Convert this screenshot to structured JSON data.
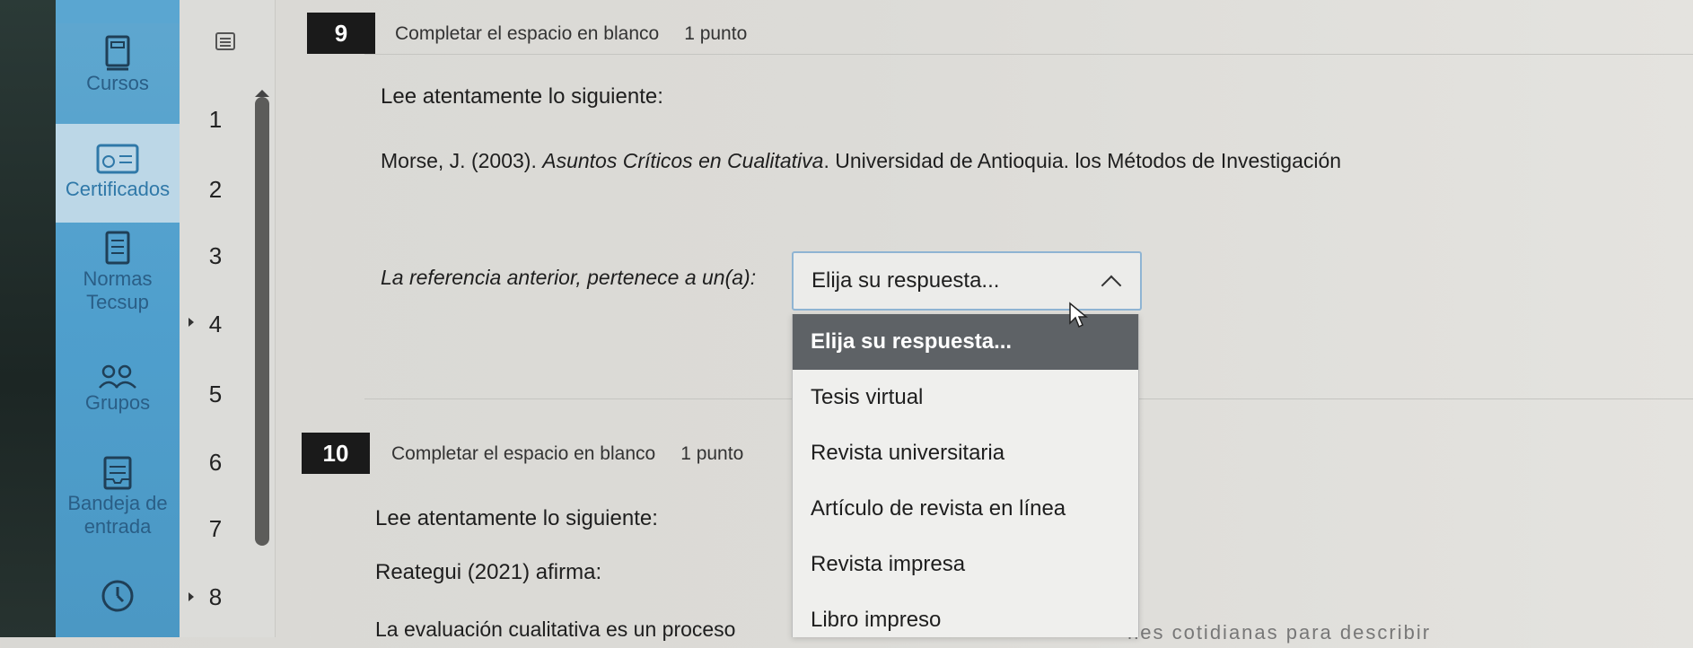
{
  "nav": {
    "items": [
      {
        "label": "Cursos",
        "icon": "book-icon",
        "active": false
      },
      {
        "label": "Certificados",
        "icon": "certificate-icon",
        "active": true
      },
      {
        "label": "Normas\nTecsup",
        "icon": "document-icon",
        "active": false
      },
      {
        "label": "Grupos",
        "icon": "groups-icon",
        "active": false
      },
      {
        "label": "Bandeja de\nentrada",
        "icon": "inbox-icon",
        "active": false
      },
      {
        "label": "",
        "icon": "clock-icon",
        "active": false
      }
    ]
  },
  "question_nav": {
    "numbers": [
      "1",
      "2",
      "3",
      "4",
      "5",
      "6",
      "7",
      "8"
    ]
  },
  "q9": {
    "number": "9",
    "type": "Completar el espacio en blanco",
    "points": "1 punto",
    "intro": "Lee atentamente lo siguiente:",
    "reference_prefix": "Morse, J. (2003). ",
    "reference_title": "Asuntos Críticos en Cualitativa",
    "reference_suffix": ". Universidad de Antioquia. los Métodos de Investigación",
    "prompt": "La referencia anterior, pertenece a un(a):",
    "select_value": "Elija su respuesta...",
    "options": [
      "Elija su respuesta...",
      "Tesis virtual",
      "Revista universitaria",
      "Artículo de revista en línea",
      "Revista impresa",
      "Libro impreso"
    ],
    "selected_option": "Elija su respuesta..."
  },
  "q10": {
    "number": "10",
    "type": "Completar el espacio en blanco",
    "points": "1 punto",
    "intro": "Lee atentamente lo siguiente:",
    "quote_intro": "Reategui (2021) afirma:",
    "quote_start": "La evaluación cualitativa es un proceso",
    "quote_end": "nes cotidianas para describir"
  }
}
